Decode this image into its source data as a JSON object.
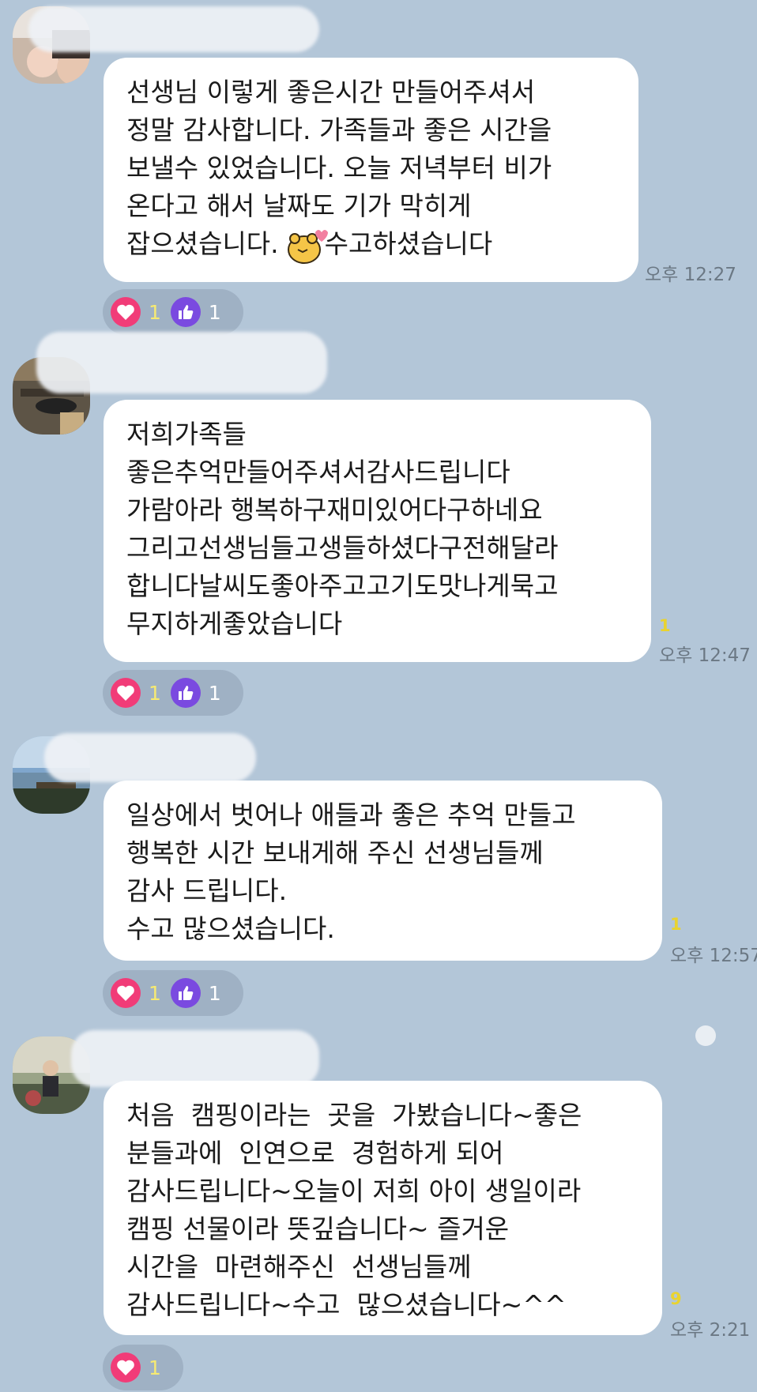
{
  "messages": [
    {
      "lines": [
        "선생님 이렇게 좋은시간 만들어주셔서",
        "정말 감사합니다. 가족들과 좋은 시간을",
        "보낼수 있었습니다. 오늘 저녁부터 비가",
        "온다고 해서 날짜도 기가 막히게",
        "잡으셨습니다."
      ],
      "line_after_emoticon": "수고하셨습니다",
      "emoticon": "bear-heart-emoticon",
      "time": "오후 12:27",
      "unread": "",
      "reactions": {
        "heart": "1",
        "thumb": "1"
      }
    },
    {
      "lines": [
        "저희가족들",
        "좋은추억만들어주셔서감사드립니다",
        "가람아라 행복하구재미있어다구하네요",
        "그리고선생님들고생들하셨다구전해달라",
        "합니다날씨도좋아주고고기도맛나게묵고",
        "무지하게좋았습니다"
      ],
      "time": "오후 12:47",
      "unread": "1",
      "reactions": {
        "heart": "1",
        "thumb": "1"
      }
    },
    {
      "lines": [
        "일상에서 벗어나 애들과 좋은 추억 만들고",
        "행복한 시간 보내게해 주신 선생님들께",
        "감사 드립니다.",
        "수고 많으셨습니다."
      ],
      "time": "오후 12:57",
      "unread": "1",
      "reactions": {
        "heart": "1",
        "thumb": "1"
      }
    },
    {
      "lines": [
        "처음  캠핑이라는  곳을  가봤습니다~좋은",
        "분들과에  인연으로  경험하게 되어",
        "감사드립니다~오늘이 저희 아이 생일이라",
        "캠핑 선물이라 뜻깊습니다~ 즐거운",
        "시간을  마련해주신  선생님들께",
        "감사드립니다~수고  많으셨습니다~^^"
      ],
      "time": "오후 2:21",
      "unread": "9",
      "reactions": {
        "heart": "1"
      }
    }
  ],
  "colors": {
    "background": "#b3c6d8",
    "bubble": "#ffffff",
    "heart": "#f13c78",
    "thumb": "#7a4ae0",
    "unread": "#e9d32f"
  },
  "icons": [
    "heart-icon",
    "thumbs-up-icon",
    "avatar-image"
  ]
}
